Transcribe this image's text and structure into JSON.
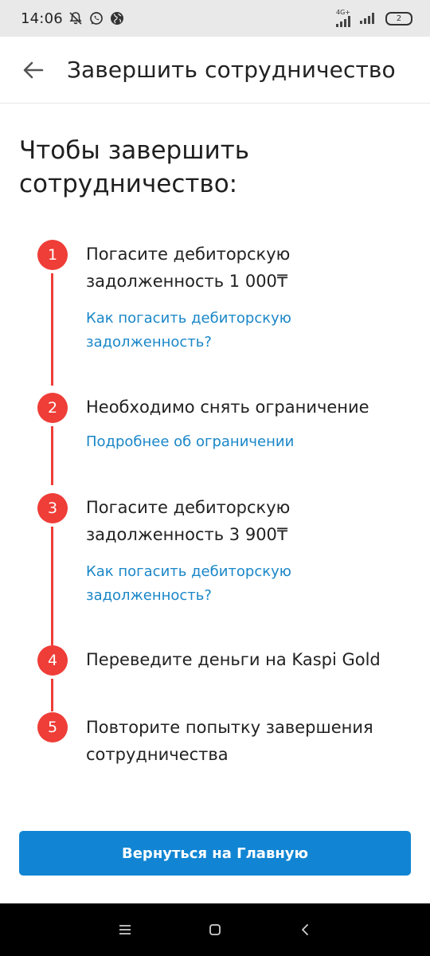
{
  "status_bar": {
    "time": "14:06",
    "network": "4G+",
    "battery_level": "2"
  },
  "header": {
    "title": "Завершить сотрудничество"
  },
  "main": {
    "heading": "Чтобы завершить сотрудничество:",
    "steps": [
      {
        "number": "1",
        "text": "Погасите дебиторскую задолженность 1 000₸",
        "link": "Как погасить дебиторскую задолженность?"
      },
      {
        "number": "2",
        "text": "Необходимо снять ограничение",
        "link": "Подробнее об ограничении"
      },
      {
        "number": "3",
        "text": "Погасите дебиторскую задолженность 3 900₸",
        "link": "Как погасить дебиторскую задолженность?"
      },
      {
        "number": "4",
        "text": "Переведите деньги на Kaspi Gold"
      },
      {
        "number": "5",
        "text": "Повторите попытку завершения сотрудничества"
      }
    ],
    "button_label": "Вернуться на Главную"
  },
  "colors": {
    "step_accent": "#ef3d37",
    "link": "#1a87c8",
    "primary_button": "#1185d3",
    "status_bar_bg": "#e9e9ea",
    "nav_bar_bg": "#000000"
  },
  "icons": {
    "back": "arrow-left-icon",
    "status": [
      "mute-notifications-icon",
      "whatsapp-icon",
      "globe-icon"
    ],
    "nav": [
      "menu-icon",
      "home-icon",
      "back-icon"
    ]
  }
}
